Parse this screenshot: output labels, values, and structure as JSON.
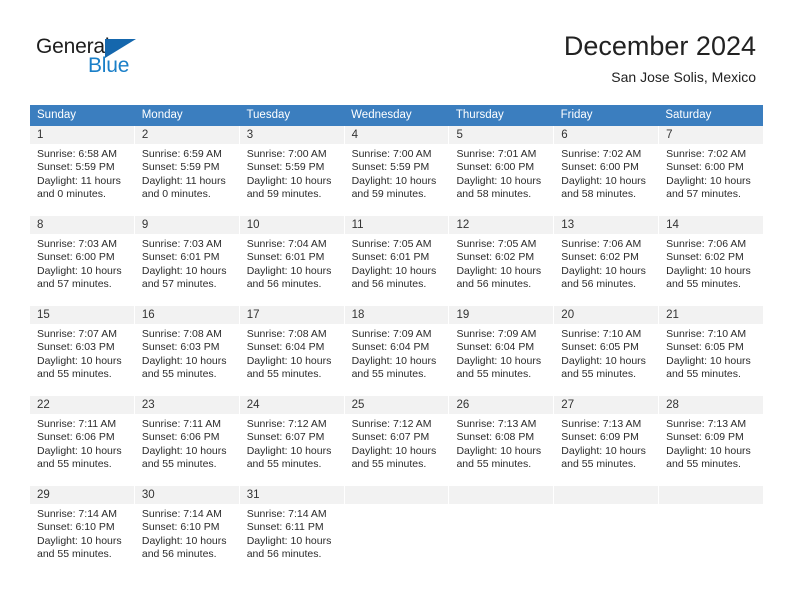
{
  "brand": {
    "name_primary": "General",
    "name_secondary": "Blue",
    "triangle_color": "#1567ad",
    "secondary_color": "#1a7fc8"
  },
  "header": {
    "title": "December 2024",
    "subtitle": "San Jose Solis, Mexico"
  },
  "theme": {
    "header_row_bg": "#3b7ebf",
    "header_row_text": "#ffffff",
    "day_number_bg": "#f2f2f2",
    "cell_bg": "#ffffff",
    "text_color": "#2b2b2b"
  },
  "weekdays": [
    "Sunday",
    "Monday",
    "Tuesday",
    "Wednesday",
    "Thursday",
    "Friday",
    "Saturday"
  ],
  "weeks": [
    [
      {
        "day": "1",
        "sunrise": "Sunrise: 6:58 AM",
        "sunset": "Sunset: 5:59 PM",
        "daylight1": "Daylight: 11 hours",
        "daylight2": "and 0 minutes."
      },
      {
        "day": "2",
        "sunrise": "Sunrise: 6:59 AM",
        "sunset": "Sunset: 5:59 PM",
        "daylight1": "Daylight: 11 hours",
        "daylight2": "and 0 minutes."
      },
      {
        "day": "3",
        "sunrise": "Sunrise: 7:00 AM",
        "sunset": "Sunset: 5:59 PM",
        "daylight1": "Daylight: 10 hours",
        "daylight2": "and 59 minutes."
      },
      {
        "day": "4",
        "sunrise": "Sunrise: 7:00 AM",
        "sunset": "Sunset: 5:59 PM",
        "daylight1": "Daylight: 10 hours",
        "daylight2": "and 59 minutes."
      },
      {
        "day": "5",
        "sunrise": "Sunrise: 7:01 AM",
        "sunset": "Sunset: 6:00 PM",
        "daylight1": "Daylight: 10 hours",
        "daylight2": "and 58 minutes."
      },
      {
        "day": "6",
        "sunrise": "Sunrise: 7:02 AM",
        "sunset": "Sunset: 6:00 PM",
        "daylight1": "Daylight: 10 hours",
        "daylight2": "and 58 minutes."
      },
      {
        "day": "7",
        "sunrise": "Sunrise: 7:02 AM",
        "sunset": "Sunset: 6:00 PM",
        "daylight1": "Daylight: 10 hours",
        "daylight2": "and 57 minutes."
      }
    ],
    [
      {
        "day": "8",
        "sunrise": "Sunrise: 7:03 AM",
        "sunset": "Sunset: 6:00 PM",
        "daylight1": "Daylight: 10 hours",
        "daylight2": "and 57 minutes."
      },
      {
        "day": "9",
        "sunrise": "Sunrise: 7:03 AM",
        "sunset": "Sunset: 6:01 PM",
        "daylight1": "Daylight: 10 hours",
        "daylight2": "and 57 minutes."
      },
      {
        "day": "10",
        "sunrise": "Sunrise: 7:04 AM",
        "sunset": "Sunset: 6:01 PM",
        "daylight1": "Daylight: 10 hours",
        "daylight2": "and 56 minutes."
      },
      {
        "day": "11",
        "sunrise": "Sunrise: 7:05 AM",
        "sunset": "Sunset: 6:01 PM",
        "daylight1": "Daylight: 10 hours",
        "daylight2": "and 56 minutes."
      },
      {
        "day": "12",
        "sunrise": "Sunrise: 7:05 AM",
        "sunset": "Sunset: 6:02 PM",
        "daylight1": "Daylight: 10 hours",
        "daylight2": "and 56 minutes."
      },
      {
        "day": "13",
        "sunrise": "Sunrise: 7:06 AM",
        "sunset": "Sunset: 6:02 PM",
        "daylight1": "Daylight: 10 hours",
        "daylight2": "and 56 minutes."
      },
      {
        "day": "14",
        "sunrise": "Sunrise: 7:06 AM",
        "sunset": "Sunset: 6:02 PM",
        "daylight1": "Daylight: 10 hours",
        "daylight2": "and 55 minutes."
      }
    ],
    [
      {
        "day": "15",
        "sunrise": "Sunrise: 7:07 AM",
        "sunset": "Sunset: 6:03 PM",
        "daylight1": "Daylight: 10 hours",
        "daylight2": "and 55 minutes."
      },
      {
        "day": "16",
        "sunrise": "Sunrise: 7:08 AM",
        "sunset": "Sunset: 6:03 PM",
        "daylight1": "Daylight: 10 hours",
        "daylight2": "and 55 minutes."
      },
      {
        "day": "17",
        "sunrise": "Sunrise: 7:08 AM",
        "sunset": "Sunset: 6:04 PM",
        "daylight1": "Daylight: 10 hours",
        "daylight2": "and 55 minutes."
      },
      {
        "day": "18",
        "sunrise": "Sunrise: 7:09 AM",
        "sunset": "Sunset: 6:04 PM",
        "daylight1": "Daylight: 10 hours",
        "daylight2": "and 55 minutes."
      },
      {
        "day": "19",
        "sunrise": "Sunrise: 7:09 AM",
        "sunset": "Sunset: 6:04 PM",
        "daylight1": "Daylight: 10 hours",
        "daylight2": "and 55 minutes."
      },
      {
        "day": "20",
        "sunrise": "Sunrise: 7:10 AM",
        "sunset": "Sunset: 6:05 PM",
        "daylight1": "Daylight: 10 hours",
        "daylight2": "and 55 minutes."
      },
      {
        "day": "21",
        "sunrise": "Sunrise: 7:10 AM",
        "sunset": "Sunset: 6:05 PM",
        "daylight1": "Daylight: 10 hours",
        "daylight2": "and 55 minutes."
      }
    ],
    [
      {
        "day": "22",
        "sunrise": "Sunrise: 7:11 AM",
        "sunset": "Sunset: 6:06 PM",
        "daylight1": "Daylight: 10 hours",
        "daylight2": "and 55 minutes."
      },
      {
        "day": "23",
        "sunrise": "Sunrise: 7:11 AM",
        "sunset": "Sunset: 6:06 PM",
        "daylight1": "Daylight: 10 hours",
        "daylight2": "and 55 minutes."
      },
      {
        "day": "24",
        "sunrise": "Sunrise: 7:12 AM",
        "sunset": "Sunset: 6:07 PM",
        "daylight1": "Daylight: 10 hours",
        "daylight2": "and 55 minutes."
      },
      {
        "day": "25",
        "sunrise": "Sunrise: 7:12 AM",
        "sunset": "Sunset: 6:07 PM",
        "daylight1": "Daylight: 10 hours",
        "daylight2": "and 55 minutes."
      },
      {
        "day": "26",
        "sunrise": "Sunrise: 7:13 AM",
        "sunset": "Sunset: 6:08 PM",
        "daylight1": "Daylight: 10 hours",
        "daylight2": "and 55 minutes."
      },
      {
        "day": "27",
        "sunrise": "Sunrise: 7:13 AM",
        "sunset": "Sunset: 6:09 PM",
        "daylight1": "Daylight: 10 hours",
        "daylight2": "and 55 minutes."
      },
      {
        "day": "28",
        "sunrise": "Sunrise: 7:13 AM",
        "sunset": "Sunset: 6:09 PM",
        "daylight1": "Daylight: 10 hours",
        "daylight2": "and 55 minutes."
      }
    ],
    [
      {
        "day": "29",
        "sunrise": "Sunrise: 7:14 AM",
        "sunset": "Sunset: 6:10 PM",
        "daylight1": "Daylight: 10 hours",
        "daylight2": "and 55 minutes."
      },
      {
        "day": "30",
        "sunrise": "Sunrise: 7:14 AM",
        "sunset": "Sunset: 6:10 PM",
        "daylight1": "Daylight: 10 hours",
        "daylight2": "and 56 minutes."
      },
      {
        "day": "31",
        "sunrise": "Sunrise: 7:14 AM",
        "sunset": "Sunset: 6:11 PM",
        "daylight1": "Daylight: 10 hours",
        "daylight2": "and 56 minutes."
      },
      {
        "day": "",
        "sunrise": "",
        "sunset": "",
        "daylight1": "",
        "daylight2": ""
      },
      {
        "day": "",
        "sunrise": "",
        "sunset": "",
        "daylight1": "",
        "daylight2": ""
      },
      {
        "day": "",
        "sunrise": "",
        "sunset": "",
        "daylight1": "",
        "daylight2": ""
      },
      {
        "day": "",
        "sunrise": "",
        "sunset": "",
        "daylight1": "",
        "daylight2": ""
      }
    ]
  ]
}
